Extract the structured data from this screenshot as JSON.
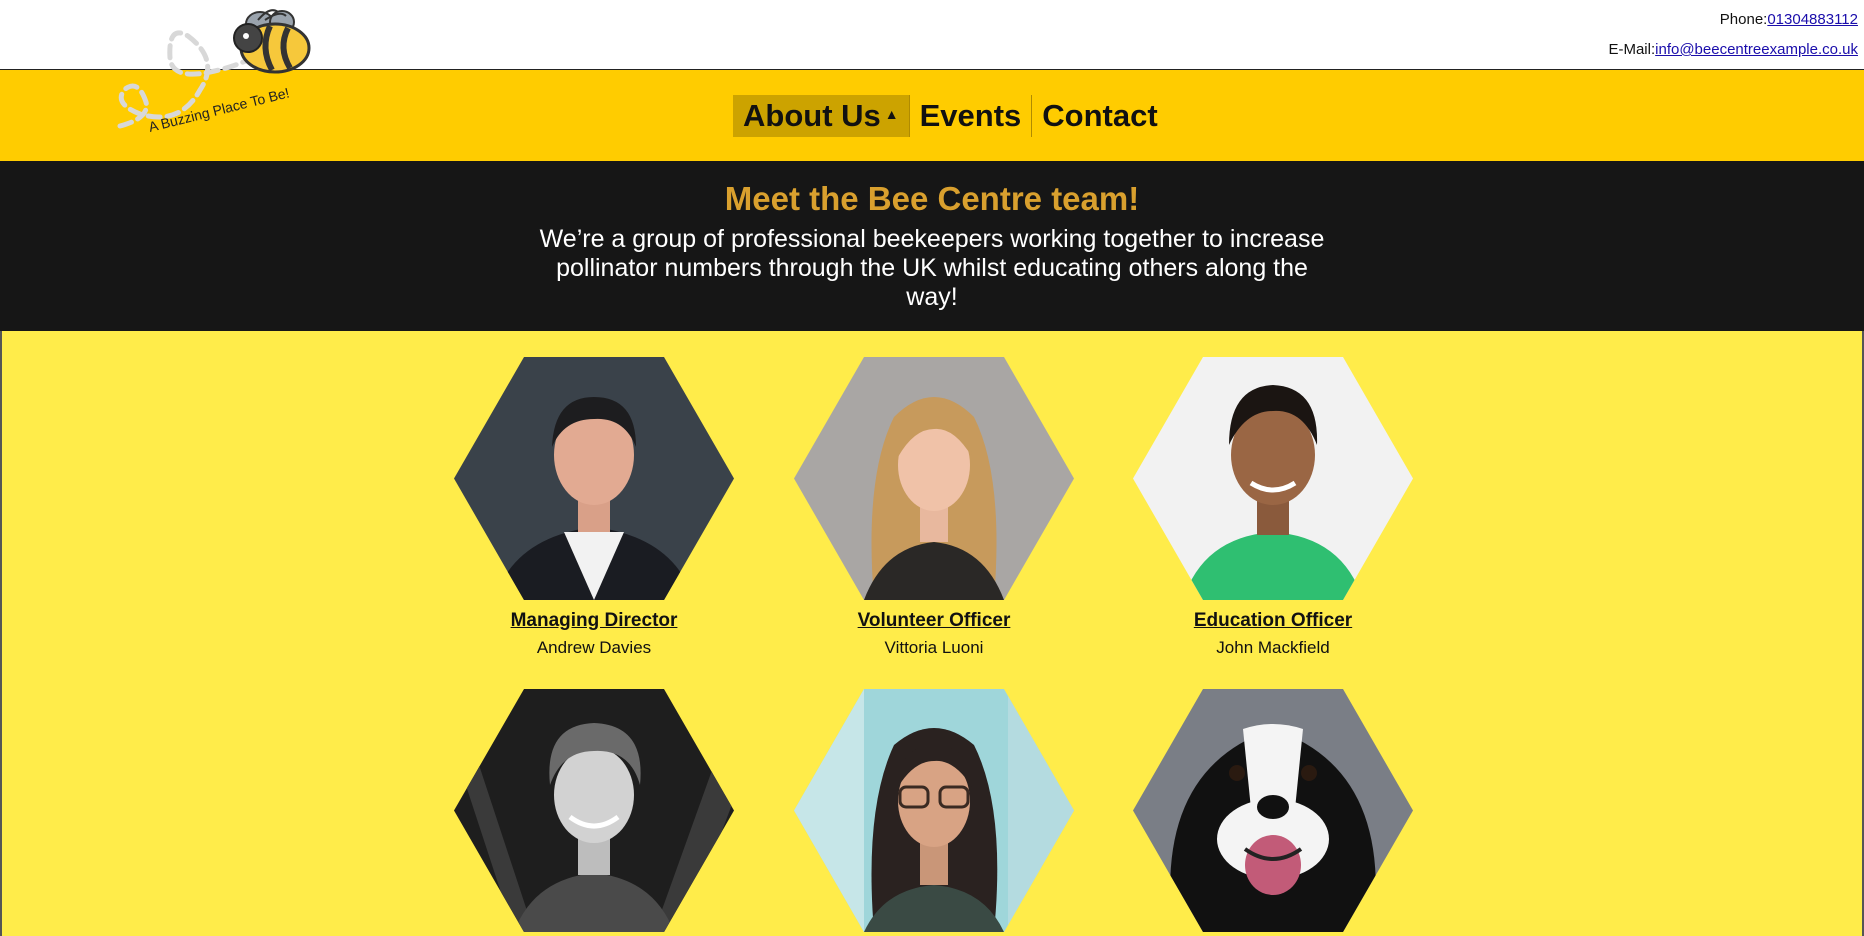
{
  "contact": {
    "phone_label": "Phone:",
    "phone_value": "01304883112",
    "email_label": "E-Mail:",
    "email_value": "info@beecentreexample.co.uk"
  },
  "logo": {
    "tagline": "A Buzzing Place To Be!"
  },
  "nav": {
    "items": [
      {
        "label": "About Us"
      },
      {
        "label": "Events"
      },
      {
        "label": "Contact"
      }
    ],
    "active_index": 0
  },
  "hero": {
    "title": "Meet the Bee Centre team!",
    "text": "We’re a group of professional beekeepers working together to increase pollinator numbers through the UK whilst educating others along the way!"
  },
  "team": [
    {
      "role": "Managing Director",
      "name": "Andrew Davies"
    },
    {
      "role": "Volunteer Officer",
      "name": "Vittoria Luoni"
    },
    {
      "role": "Education Officer",
      "name": "John Mackfield"
    },
    {
      "role": "",
      "name": ""
    },
    {
      "role": "",
      "name": ""
    },
    {
      "role": "",
      "name": ""
    }
  ],
  "colors": {
    "nav_bg": "#ffcc00",
    "page_bg": "#ffec4a",
    "hero_bg": "#161616",
    "hero_title": "#d9a02e",
    "active_tab": "#cca300"
  }
}
